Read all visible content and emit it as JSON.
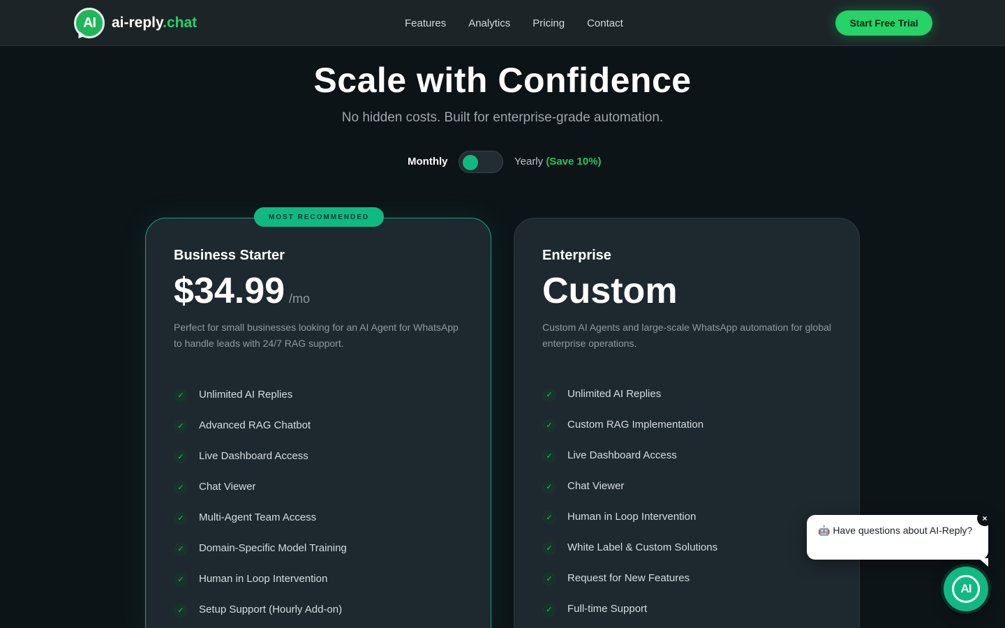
{
  "nav": {
    "logo_mark": "AI",
    "logo_text_main": "ai-reply",
    "logo_text_dot": ".chat",
    "links": [
      "Features",
      "Analytics",
      "Pricing",
      "Contact"
    ],
    "cta": "Start Free Trial"
  },
  "hero": {
    "title": "Scale with Confidence",
    "subtitle": "No hidden costs. Built for enterprise-grade automation."
  },
  "billing": {
    "monthly": "Monthly",
    "yearly": "Yearly",
    "save": "(Save 10%)",
    "selected": "Monthly"
  },
  "plans": {
    "starter": {
      "badge": "MOST RECOMMENDED",
      "name": "Business Starter",
      "price": "$34.99",
      "unit": "/mo",
      "description": "Perfect for small businesses looking for an AI Agent for WhatsApp to handle leads with 24/7 RAG support.",
      "features": [
        "Unlimited AI Replies",
        "Advanced RAG Chatbot",
        "Live Dashboard Access",
        "Chat Viewer",
        "Multi-Agent Team Access",
        "Domain-Specific Model Training",
        "Human in Loop Intervention",
        "Setup Support (Hourly Add-on)"
      ]
    },
    "enterprise": {
      "name": "Enterprise",
      "price": "Custom",
      "description": "Custom AI Agents and large-scale WhatsApp automation for global enterprise operations.",
      "features": [
        "Unlimited AI Replies",
        "Custom RAG Implementation",
        "Live Dashboard Access",
        "Chat Viewer",
        "Human in Loop Intervention",
        "White Label & Custom Solutions",
        "Request for New Features",
        "Full-time Support"
      ]
    }
  },
  "chat": {
    "message": "🤖 Have questions about AI-Reply?",
    "close": "×",
    "launcher": "AI"
  },
  "icons": {
    "check": "✓"
  },
  "colors": {
    "accent": "#25d366",
    "teal": "#10b981",
    "background": "#0d1418",
    "card": "#1e292f"
  }
}
